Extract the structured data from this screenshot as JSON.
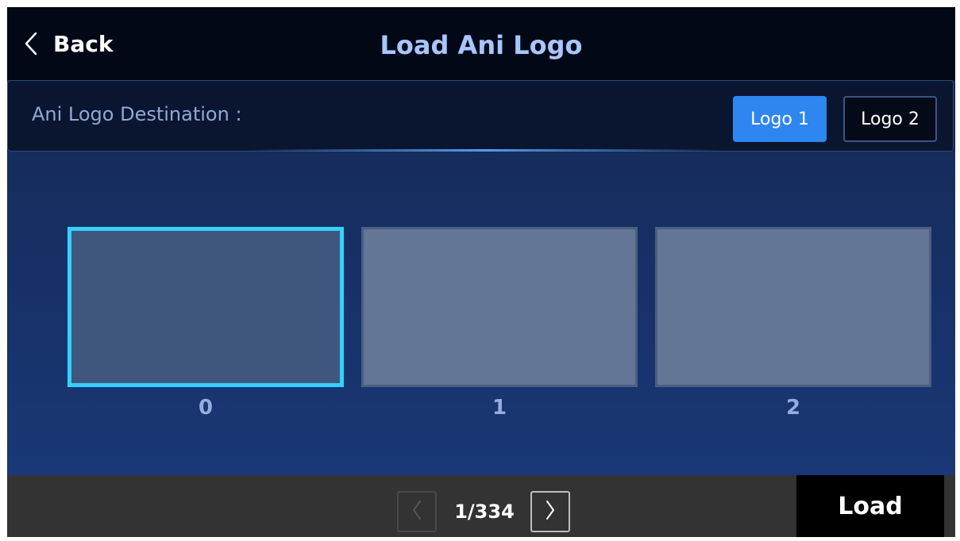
{
  "header": {
    "back_label": "Back",
    "title": "Load Ani Logo"
  },
  "destination": {
    "label": "Ani Logo Destination :",
    "options": [
      "Logo 1",
      "Logo 2"
    ],
    "selected": "Logo 1"
  },
  "thumbnails": {
    "items": [
      {
        "label": "0",
        "selected": true
      },
      {
        "label": "1",
        "selected": false
      },
      {
        "label": "2",
        "selected": false
      }
    ]
  },
  "footer": {
    "page_indicator": "1/334",
    "load_label": "Load"
  },
  "colors": {
    "accent": "#2e86f0",
    "selection": "#33d1ff",
    "title": "#a8c6ff"
  }
}
